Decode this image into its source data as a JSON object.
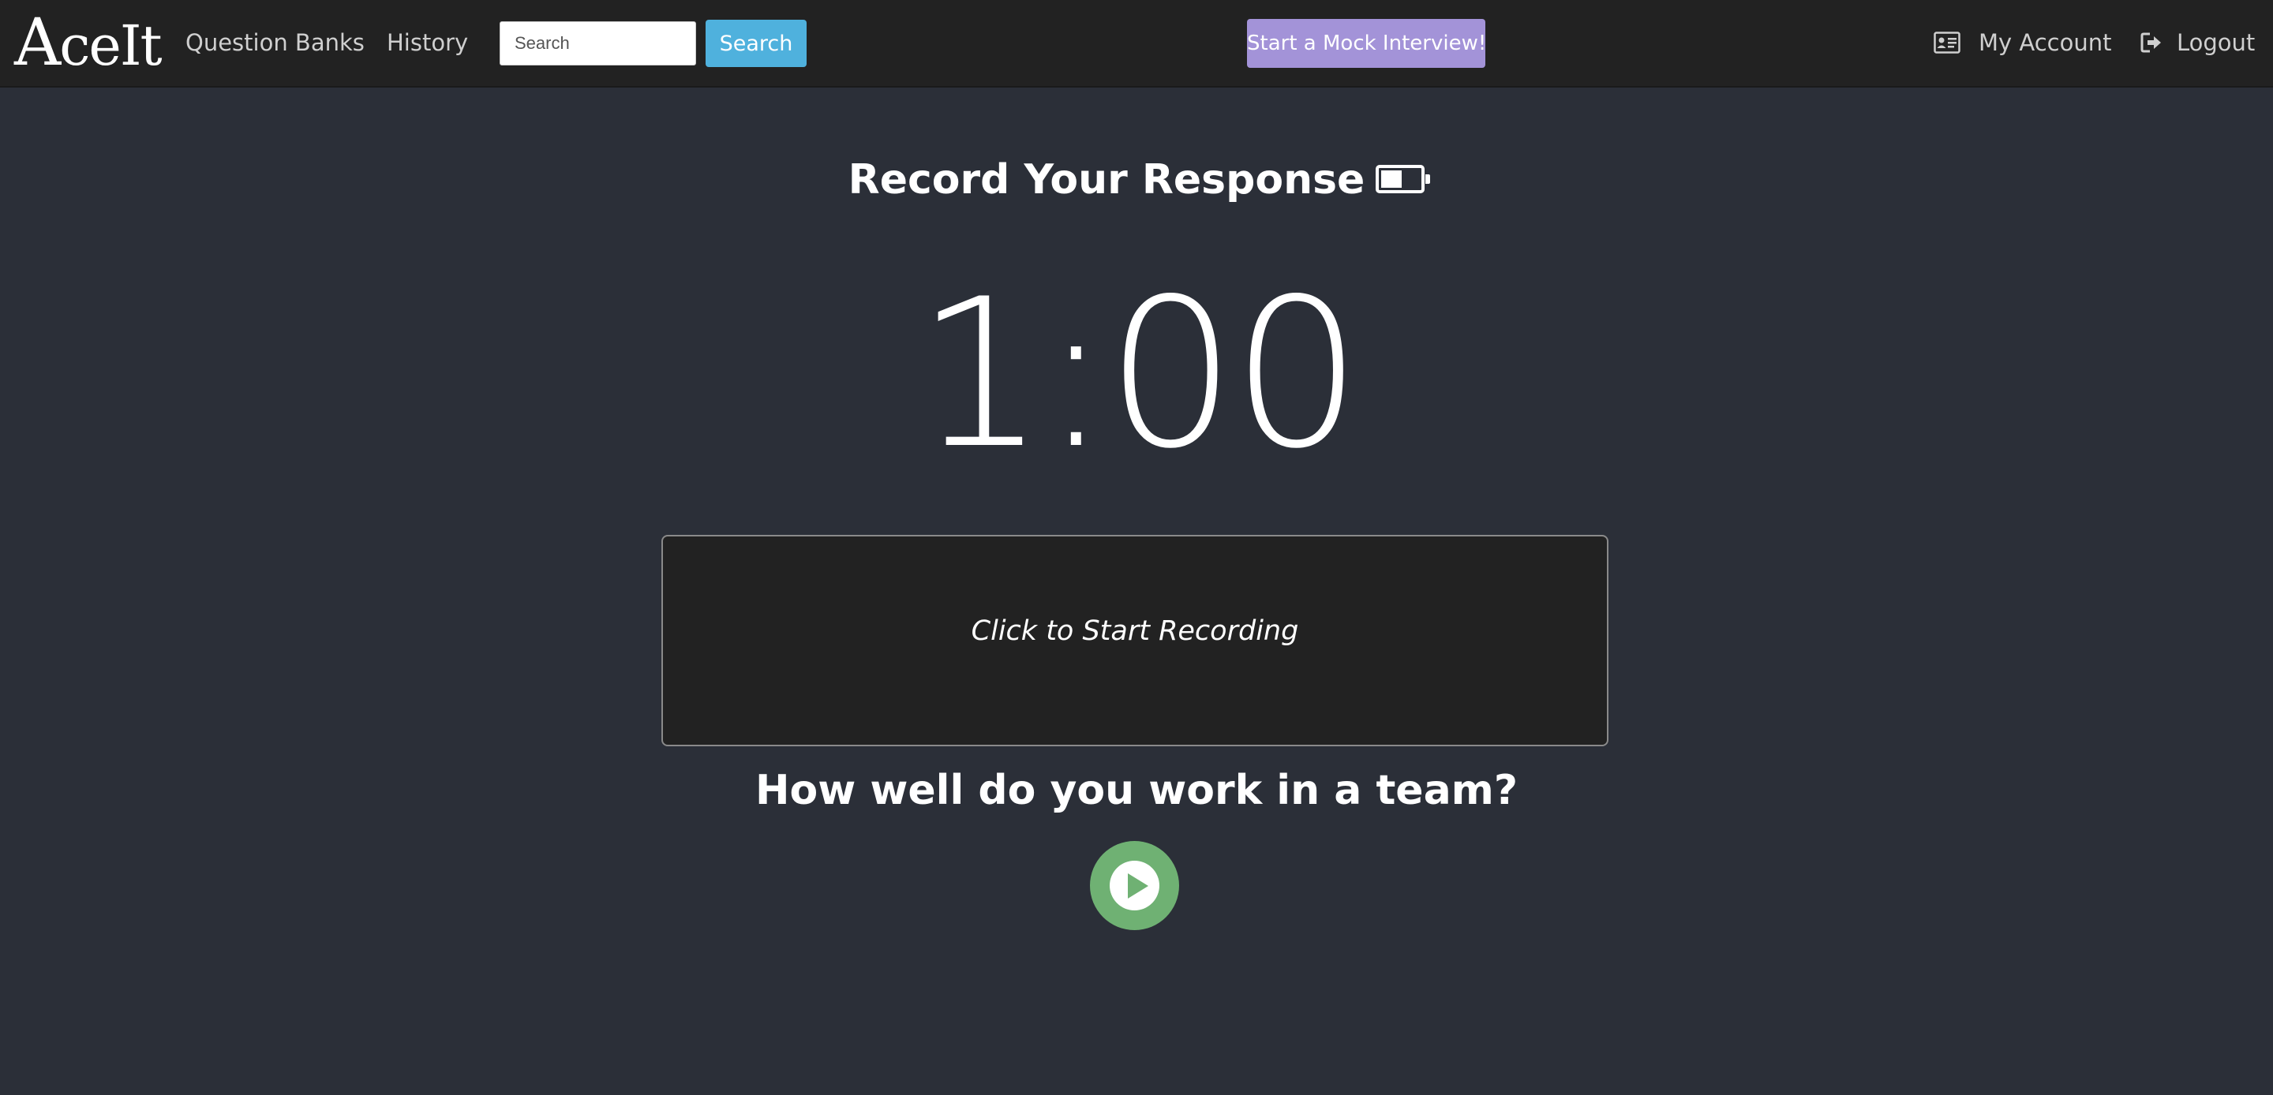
{
  "nav": {
    "brand": "AceIt",
    "brand_first": "A",
    "brand_rest": "ceIt",
    "question_banks": "Question Banks",
    "history": "History",
    "search_placeholder": "Search",
    "search_button": "Search",
    "mock_interview_button": "Start a Mock Interview!",
    "my_account": "My Account",
    "logout": "Logout"
  },
  "main": {
    "title": "Record Your Response",
    "timer": "1:00",
    "record_prompt": "Click to Start Recording",
    "question": "How well do you work in a team?"
  },
  "icons": {
    "account": "id-card-icon",
    "logout": "sign-out-icon",
    "battery": "battery-icon",
    "play": "play-icon"
  },
  "colors": {
    "background": "#2b2f38",
    "navbar": "#222222",
    "search_button": "#4fb1dd",
    "mock_button": "#a393d8",
    "play_button": "#6fb173"
  }
}
